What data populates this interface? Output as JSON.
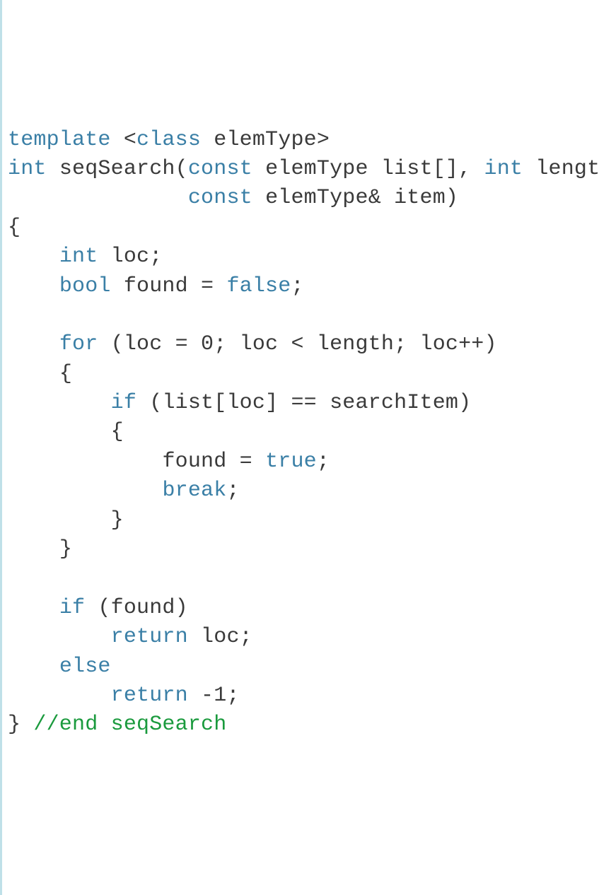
{
  "code": {
    "kw_template": "template",
    "kw_class": "class",
    "t_elemType": "elemType",
    "kw_int": "int",
    "fn_seqSearch": "seqSearch",
    "kw_const": "const",
    "p_list": "list",
    "p_length": "length",
    "p_item": "item",
    "v_loc": "loc",
    "kw_bool": "bool",
    "v_found": "found",
    "kw_false": "false",
    "kw_for": "for",
    "n_zero": "0",
    "kw_if": "if",
    "v_searchItem": "searchItem",
    "kw_true": "true",
    "kw_break": "break",
    "kw_return": "return",
    "kw_else": "else",
    "n_neg1": "-1",
    "comment_end": "//end seqSearch",
    "tok": {
      "lt": "<",
      "gt": ">",
      "lparen": "(",
      "rparen": ")",
      "lbrack": "[",
      "rbrack": "]",
      "lbrace": "{",
      "rbrace": "}",
      "comma": ",",
      "semi": ";",
      "amp": "&",
      "eq": "=",
      "eqeq": "==",
      "plusplus": "++"
    }
  }
}
